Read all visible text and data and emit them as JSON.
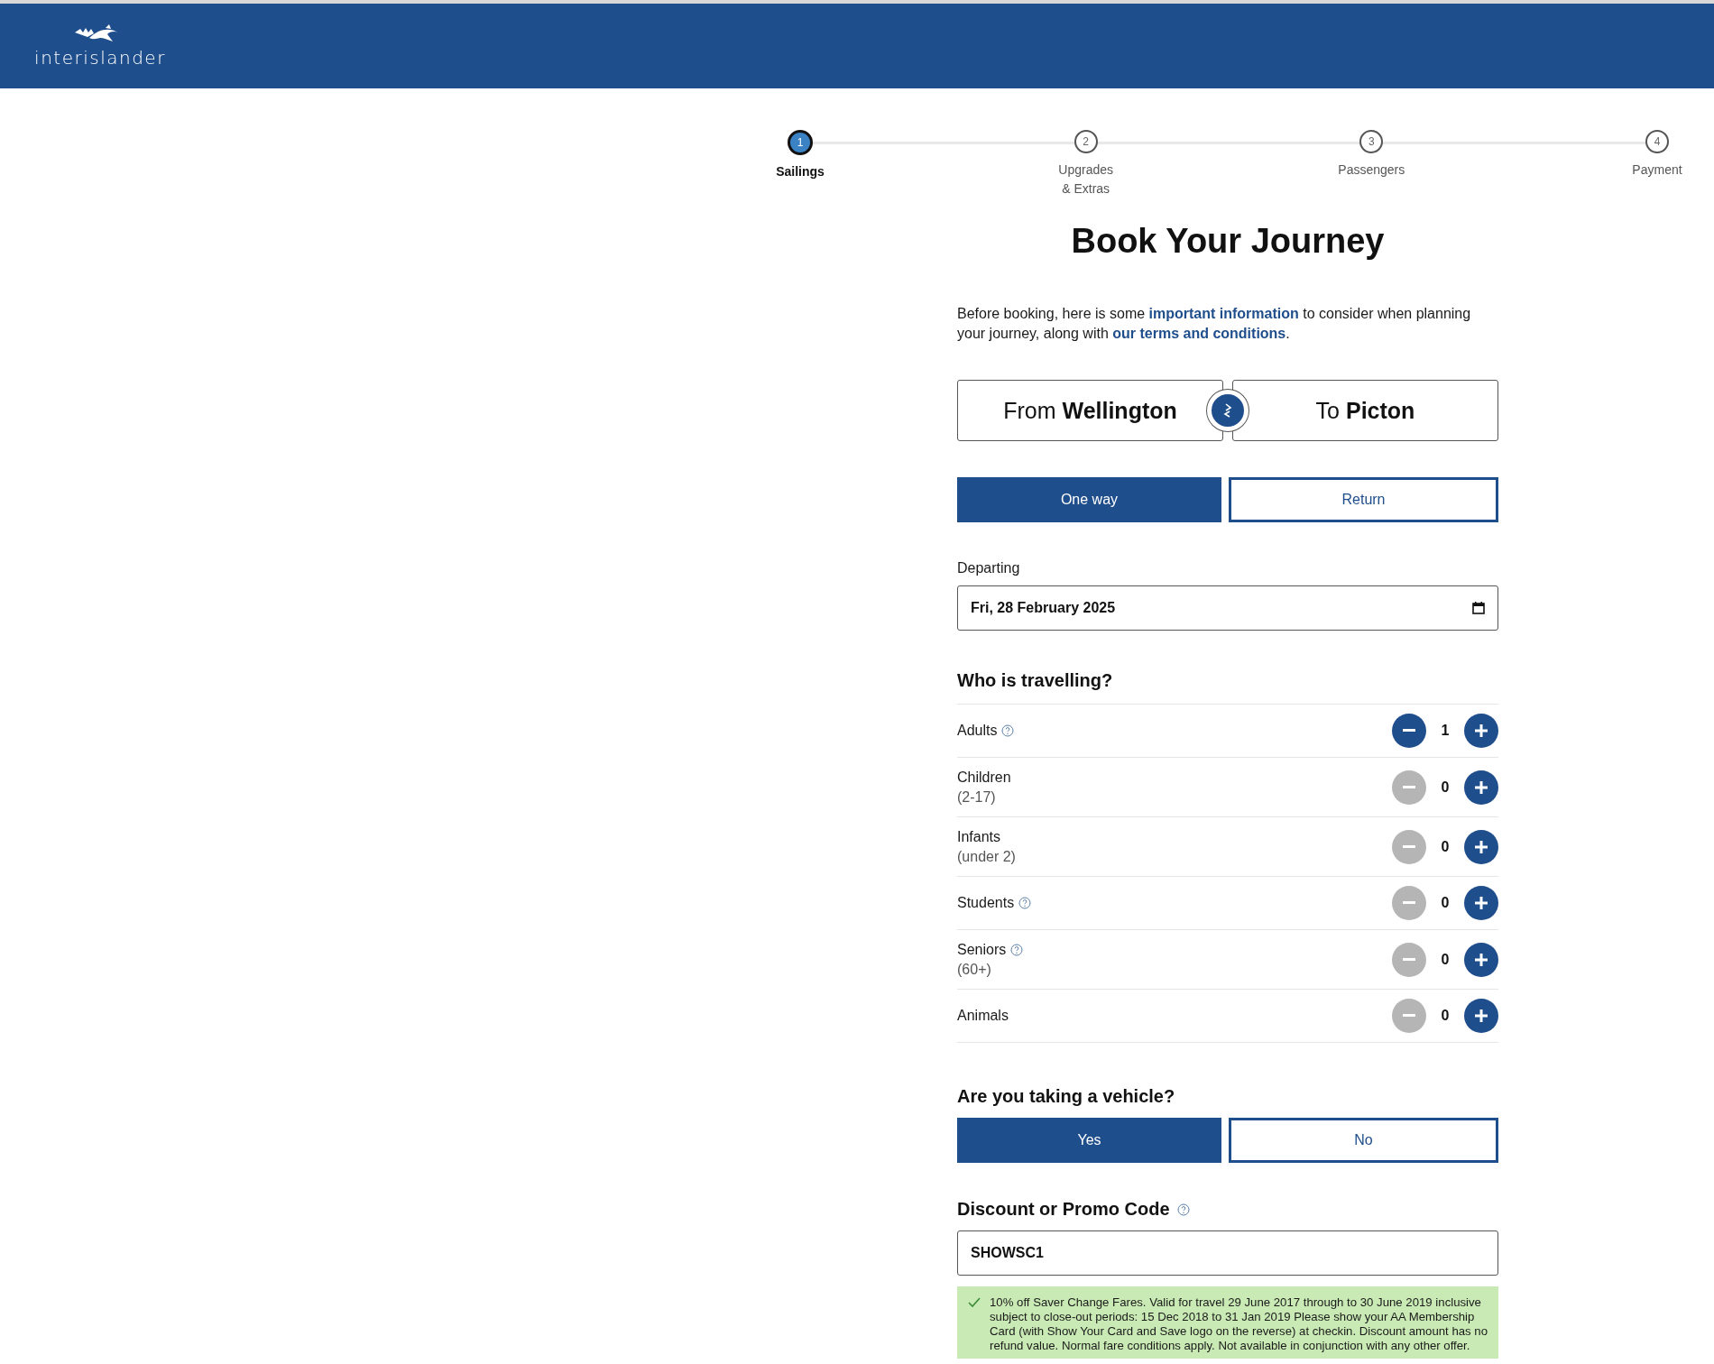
{
  "header": {
    "logo_text": "interislander"
  },
  "steps": [
    {
      "number": "1",
      "lines": [
        "Sailings"
      ],
      "selected": true
    },
    {
      "number": "2",
      "lines": [
        "Upgrades",
        "& Extras"
      ],
      "selected": false
    },
    {
      "number": "3",
      "lines": [
        "Passengers"
      ],
      "selected": false
    },
    {
      "number": "4",
      "lines": [
        "Payment"
      ],
      "selected": false
    }
  ],
  "title": "Book Your Journey",
  "intro": [
    {
      "kind": "text",
      "text": "Before booking, here is some "
    },
    {
      "kind": "link",
      "text": "important information"
    },
    {
      "kind": "text",
      "text": " to consider when planning your journey, along with "
    },
    {
      "kind": "link",
      "text": "our terms and conditions"
    },
    {
      "kind": "text",
      "text": "."
    }
  ],
  "route": {
    "from": "From **Wellington**",
    "to": "To **Picton**"
  },
  "trip_type": [
    {
      "label": "One way",
      "selected": true
    },
    {
      "label": "Return",
      "selected": false
    }
  ],
  "departing": {
    "label": "Departing",
    "value": "Fri, 28 February 2025"
  },
  "travellers": {
    "heading": "Who is travelling?",
    "rows": [
      {
        "label": "Adults",
        "help": true,
        "count": "1",
        "minus_disabled": false
      },
      {
        "label": "Children",
        "sublabel": "(2-17)",
        "help": false,
        "count": "0",
        "minus_disabled": true
      },
      {
        "label": "Infants",
        "sublabel": "(under 2)",
        "help": false,
        "count": "0",
        "minus_disabled": true
      },
      {
        "label": "Students",
        "help": true,
        "count": "0",
        "minus_disabled": true
      },
      {
        "label": "Seniors",
        "sublabel": "(60+)",
        "help": true,
        "count": "0",
        "minus_disabled": true
      },
      {
        "label": "Animals",
        "help": false,
        "count": "0",
        "minus_disabled": true
      }
    ]
  },
  "vehicle": {
    "heading": "Are you taking a vehicle?",
    "options": [
      {
        "label": "Yes",
        "selected": true
      },
      {
        "label": "No",
        "selected": false
      }
    ]
  },
  "promo": {
    "heading": "Discount or Promo Code",
    "value": "SHOWSC1",
    "message": "10% off Saver Change Fares. Valid for travel 29 June 2017 through to 30 June 2019 inclusive subject to close-out periods: 15 Dec 2018 to 31 Jan 2019 Please show your AA Membership Card (with Show Your Card and Save logo on the reverse) at checkin. Discount amount has no refund value. Normal fare conditions apply. Not available in conjunction with any other offer."
  }
}
